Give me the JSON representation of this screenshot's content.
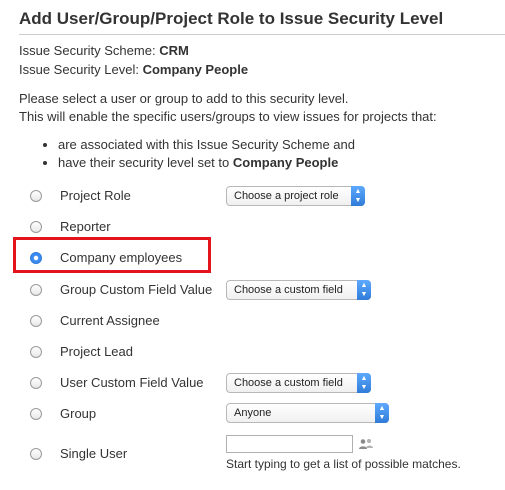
{
  "header": {
    "title": "Add User/Group/Project Role to Issue Security Level"
  },
  "info": {
    "scheme_label": "Issue Security Scheme:",
    "scheme_value": "CRM",
    "level_label": "Issue Security Level:",
    "level_value": "Company People"
  },
  "description": {
    "line1": "Please select a user or group to add to this security level.",
    "line2": "This will enable the specific users/groups to view issues for projects that:",
    "bullets": [
      {
        "text": "are associated with this Issue Security Scheme and"
      },
      {
        "text": "have their security level set to",
        "bold": "Company People"
      }
    ]
  },
  "options": [
    {
      "label": "Project Role",
      "checked": false,
      "control": "Choose a project role"
    },
    {
      "label": "Reporter",
      "checked": false
    },
    {
      "label": "Company employees",
      "checked": true
    },
    {
      "label": "Group Custom Field Value",
      "checked": false,
      "control": "Choose a custom field"
    },
    {
      "label": "Current Assignee",
      "checked": false
    },
    {
      "label": "Project Lead",
      "checked": false
    },
    {
      "label": "User Custom Field Value",
      "checked": false,
      "control": "Choose a custom field"
    },
    {
      "label": "Group",
      "checked": false,
      "control": "Anyone"
    },
    {
      "label": "Single User",
      "checked": false
    }
  ],
  "single_user": {
    "input_value": "",
    "hint": "Start typing to get a list of possible matches."
  },
  "colors": {
    "highlight": "#e3141c",
    "radio_selected": "#3b8cf0"
  }
}
